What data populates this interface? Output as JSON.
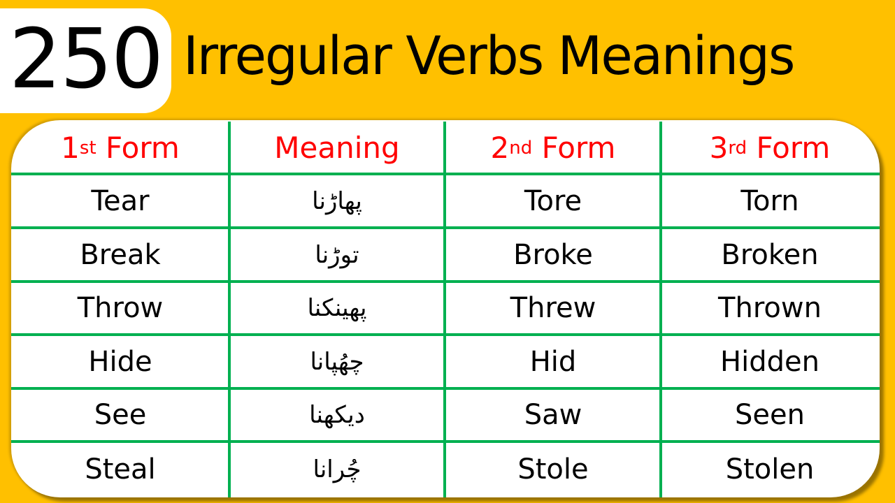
{
  "header": {
    "count": "250",
    "title": "Irregular Verbs Meanings"
  },
  "colors": {
    "background": "#FFC000",
    "header_text": "#FF0000",
    "grid_lines": "#00B050",
    "body_text": "#000000"
  },
  "table": {
    "columns": [
      {
        "num": "1",
        "suffix": "st",
        "label": "Form"
      },
      {
        "num": "",
        "suffix": "",
        "label": "Meaning"
      },
      {
        "num": "2",
        "suffix": "nd",
        "label": "Form"
      },
      {
        "num": "3",
        "suffix": "rd",
        "label": "Form"
      }
    ],
    "rows": [
      {
        "first": "Tear",
        "meaning": "پھاڑنا",
        "second": "Tore",
        "third": "Torn"
      },
      {
        "first": "Break",
        "meaning": "توڑنا",
        "second": "Broke",
        "third": "Broken"
      },
      {
        "first": "Throw",
        "meaning": "پھینکنا",
        "second": "Threw",
        "third": "Thrown"
      },
      {
        "first": "Hide",
        "meaning": "چھُپانا",
        "second": "Hid",
        "third": "Hidden"
      },
      {
        "first": "See",
        "meaning": "دیکھنا",
        "second": "Saw",
        "third": "Seen"
      },
      {
        "first": "Steal",
        "meaning": "چُرانا",
        "second": "Stole",
        "third": "Stolen"
      }
    ]
  }
}
